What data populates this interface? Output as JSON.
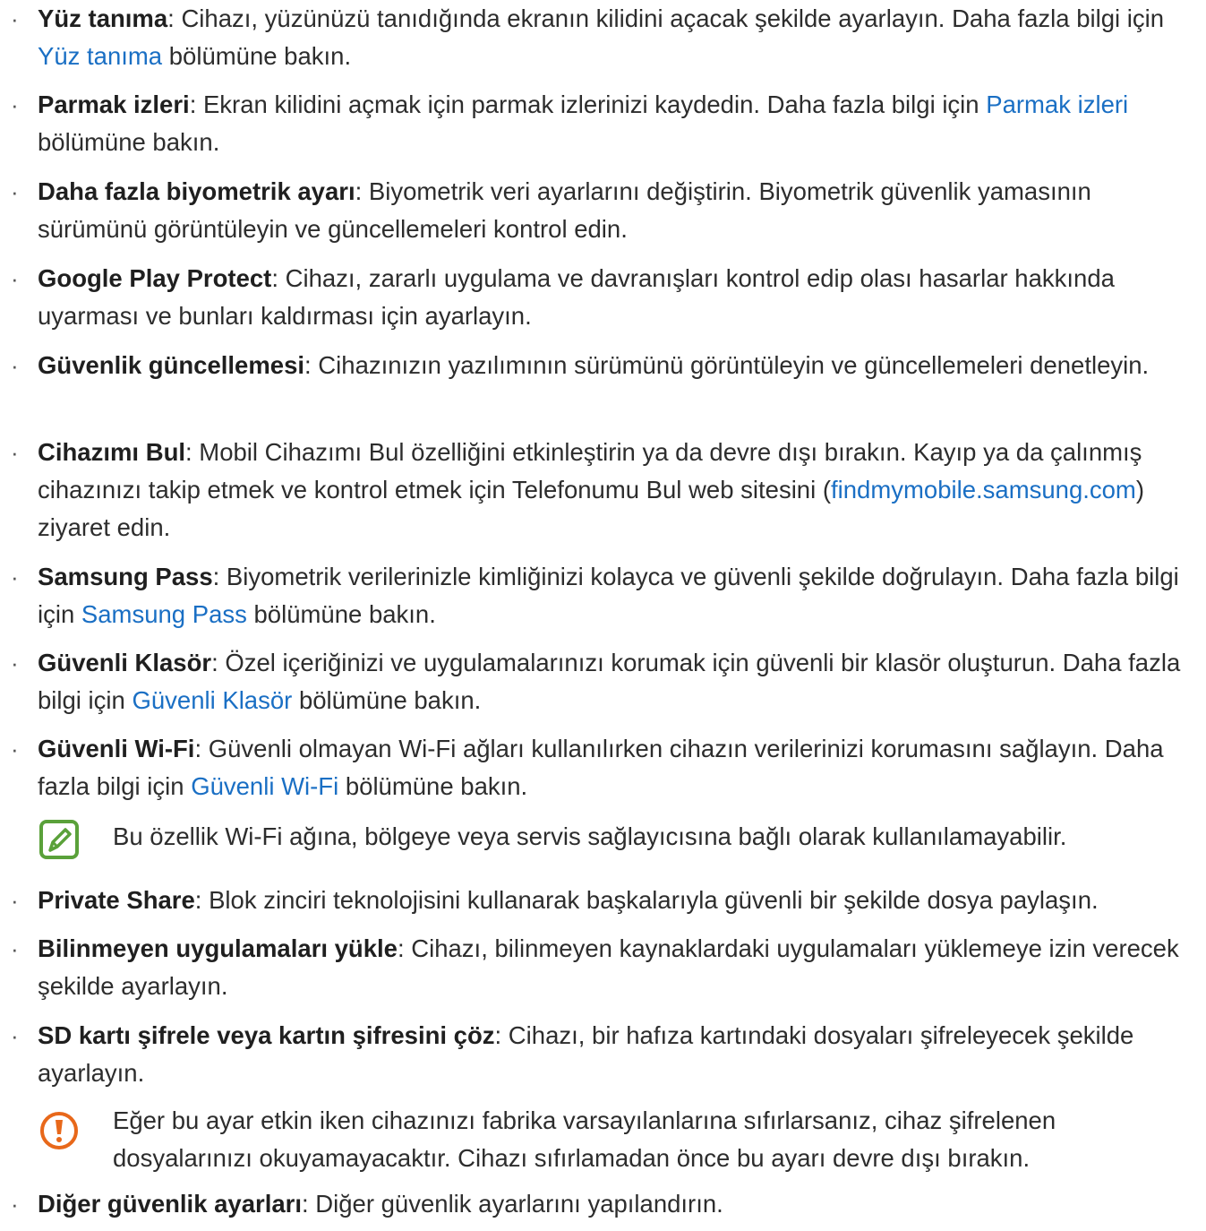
{
  "bullet_char": "·",
  "items": [
    {
      "title": "Yüz tanıma",
      "desc_before": ": Cihazı, yüzünüzü tanıdığında ekranın kilidini açacak şekilde ayarlayın. Daha fazla bilgi için ",
      "link": "Yüz tanıma",
      "desc_after": " bölümüne bakın."
    },
    {
      "title": "Parmak izleri",
      "desc_before": ": Ekran kilidini açmak için parmak izlerinizi kaydedin. Daha fazla bilgi için ",
      "link": "Parmak izleri",
      "desc_after": " bölümüne bakın."
    },
    {
      "title": "Daha fazla biyometrik ayarı",
      "desc_before": ": Biyometrik veri ayarlarını değiştirin. Biyometrik güvenlik yamasının sürümünü görüntüleyin ve güncellemeleri kontrol edin.",
      "link": "",
      "desc_after": ""
    },
    {
      "title": "Google Play Protect",
      "desc_before": ": Cihazı, zararlı uygulama ve davranışları kontrol edip olası hasarlar hakkında uyarması ve bunları kaldırması için ayarlayın.",
      "link": "",
      "desc_after": ""
    },
    {
      "title": "Güvenlik güncellemesi",
      "desc_before": ": Cihazınızın yazılımının sürümünü görüntüleyin ve güncellemeleri denetleyin.",
      "link": "",
      "desc_after": ""
    },
    {
      "title": "Cihazımı Bul",
      "desc_before": ": Mobil Cihazımı Bul özelliğini etkinleştirin ya da devre dışı bırakın. Kayıp ya da çalınmış cihazınızı takip etmek ve kontrol etmek için Telefonumu Bul web sitesini (",
      "link": "findmymobile.samsung.com",
      "desc_after": ") ziyaret edin."
    },
    {
      "title": "Samsung Pass",
      "desc_before": ": Biyometrik verilerinizle kimliğinizi kolayca ve güvenli şekilde doğrulayın. Daha fazla bilgi için ",
      "link": "Samsung Pass",
      "desc_after": " bölümüne bakın."
    },
    {
      "title": "Güvenli Klasör",
      "desc_before": ": Özel içeriğinizi ve uygulamalarınızı korumak için güvenli bir klasör oluşturun. Daha fazla bilgi için ",
      "link": "Güvenli Klasör",
      "desc_after": " bölümüne bakın."
    },
    {
      "title": "Güvenli Wi-Fi",
      "desc_before": ": Güvenli olmayan Wi-Fi ağları kullanılırken cihazın verilerinizi korumasını sağlayın. Daha fazla bilgi için ",
      "link": "Güvenli Wi-Fi",
      "desc_after": " bölümüne bakın."
    },
    {
      "title": "Private Share",
      "desc_before": ": Blok zinciri teknolojisini kullanarak başkalarıyla güvenli bir şekilde dosya paylaşın.",
      "link": "",
      "desc_after": ""
    },
    {
      "title": "Bilinmeyen uygulamaları yükle",
      "desc_before": ": Cihazı, bilinmeyen kaynaklardaki uygulamaları yüklemeye izin verecek şekilde ayarlayın.",
      "link": "",
      "desc_after": ""
    },
    {
      "title": "SD kartı şifrele veya kartın şifresini çöz",
      "desc_before": ": Cihazı, bir hafıza kartındaki dosyaları şifreleyecek şekilde ayarlayın.",
      "link": "",
      "desc_after": ""
    },
    {
      "title": "Diğer güvenlik ayarları",
      "desc_before": ": Diğer güvenlik ayarlarını yapılandırın.",
      "link": "",
      "desc_after": ""
    }
  ],
  "notes": {
    "wifi_note": {
      "icon": "note-pencil-icon",
      "color": "#5aa13a",
      "text": "Bu özellik Wi-Fi ağına, bölgeye veya servis sağlayıcısına bağlı olarak kullanılamayabilir."
    },
    "sd_caution": {
      "icon": "caution-exclamation-icon",
      "color": "#e8681a",
      "text": "Eğer bu ayar etkin iken cihazınızı fabrika varsayılanlarına sıfırlarsanız, cihaz şifrelenen dosyalarınızı okuyamayacaktır. Cihazı sıfırlamadan önce bu ayarı devre dışı bırakın."
    }
  },
  "colors": {
    "link": "#1a6fc4",
    "text": "#2d2d2d"
  }
}
